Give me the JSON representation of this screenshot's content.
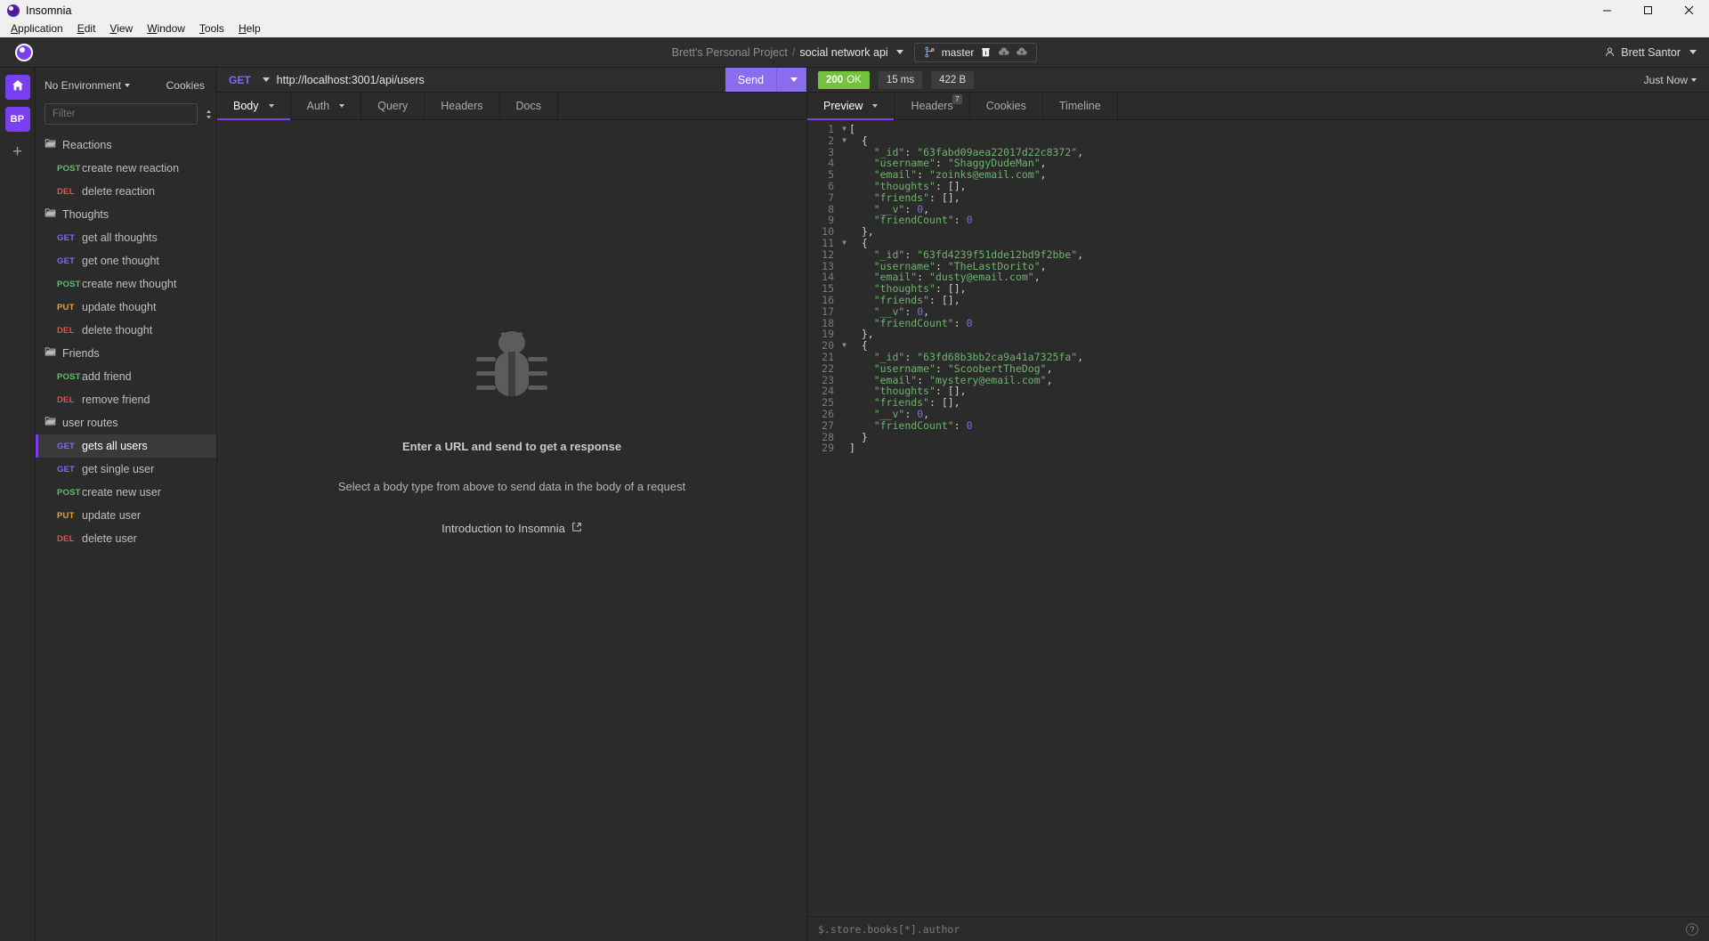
{
  "titlebar": {
    "app_name": "Insomnia",
    "minimize": "minimize-icon",
    "maximize": "maximize-icon",
    "close": "close-icon"
  },
  "menubar": {
    "items": [
      {
        "label": "Application",
        "accel": "A"
      },
      {
        "label": "Edit",
        "accel": "E"
      },
      {
        "label": "View",
        "accel": "V"
      },
      {
        "label": "Window",
        "accel": "W"
      },
      {
        "label": "Tools",
        "accel": "T"
      },
      {
        "label": "Help",
        "accel": "H"
      }
    ]
  },
  "header": {
    "project_name": "Brett's Personal Project",
    "separator": "/",
    "workspace_name": "social network api",
    "git": {
      "branch": "master",
      "icons": [
        "git-branch-icon",
        "trash-icon",
        "cloud-download-icon",
        "cloud-upload-icon"
      ]
    },
    "user": {
      "name": "Brett Santor",
      "icon": "user-icon"
    }
  },
  "rail": {
    "home_label": "home-icon",
    "project_initials": "BP",
    "add_label": "+"
  },
  "sidebar": {
    "environment": "No Environment",
    "cookies_label": "Cookies",
    "filter_placeholder": "Filter",
    "filter_value": "",
    "sort_icon": "sort-icon",
    "add_icon": "plus-circle-icon",
    "tree": [
      {
        "type": "folder",
        "name": "Reactions"
      },
      {
        "type": "request",
        "method": "POST",
        "name": "create new reaction",
        "active": false
      },
      {
        "type": "request",
        "method": "DEL",
        "name": "delete reaction",
        "active": false
      },
      {
        "type": "folder",
        "name": "Thoughts"
      },
      {
        "type": "request",
        "method": "GET",
        "name": "get all thoughts",
        "active": false
      },
      {
        "type": "request",
        "method": "GET",
        "name": "get one thought",
        "active": false
      },
      {
        "type": "request",
        "method": "POST",
        "name": "create new thought",
        "active": false
      },
      {
        "type": "request",
        "method": "PUT",
        "name": "update thought",
        "active": false
      },
      {
        "type": "request",
        "method": "DEL",
        "name": "delete thought",
        "active": false
      },
      {
        "type": "folder",
        "name": "Friends"
      },
      {
        "type": "request",
        "method": "POST",
        "name": "add friend",
        "active": false
      },
      {
        "type": "request",
        "method": "DEL",
        "name": "remove friend",
        "active": false
      },
      {
        "type": "folder",
        "name": "user routes"
      },
      {
        "type": "request",
        "method": "GET",
        "name": "gets all users",
        "active": true
      },
      {
        "type": "request",
        "method": "GET",
        "name": "get single user",
        "active": false
      },
      {
        "type": "request",
        "method": "POST",
        "name": "create new user",
        "active": false
      },
      {
        "type": "request",
        "method": "PUT",
        "name": "update user",
        "active": false
      },
      {
        "type": "request",
        "method": "DEL",
        "name": "delete user",
        "active": false
      }
    ]
  },
  "request": {
    "method": "GET",
    "url": "http://localhost:3001/api/users",
    "send_label": "Send",
    "tabs": [
      {
        "label": "Body",
        "active": true,
        "caret": true
      },
      {
        "label": "Auth",
        "active": false,
        "caret": true
      },
      {
        "label": "Query",
        "active": false,
        "caret": false
      },
      {
        "label": "Headers",
        "active": false,
        "caret": false
      },
      {
        "label": "Docs",
        "active": false,
        "caret": false
      }
    ],
    "empty": {
      "illustration": "bug-icon",
      "title": "Enter a URL and send to get a response",
      "subtitle": "Select a body type from above to send data in the body of a request",
      "link": "Introduction to Insomnia",
      "link_icon": "external-link-icon"
    }
  },
  "response": {
    "status_code": "200",
    "status_text": "OK",
    "time": "15 ms",
    "size": "422 B",
    "timestamp": "Just Now",
    "tabs": [
      {
        "label": "Preview",
        "active": true,
        "caret": true,
        "badge": ""
      },
      {
        "label": "Headers",
        "active": false,
        "caret": false,
        "badge": "7"
      },
      {
        "label": "Cookies",
        "active": false,
        "caret": false,
        "badge": ""
      },
      {
        "label": "Timeline",
        "active": false,
        "caret": false,
        "badge": ""
      }
    ],
    "filter_placeholder": "$.store.books[*].author",
    "filter_value": "",
    "help_icon": "question-mark-icon",
    "lines": [
      {
        "n": 1,
        "fold": true,
        "tokens": [
          {
            "t": "[",
            "c": "p"
          }
        ],
        "indent": 0
      },
      {
        "n": 2,
        "fold": true,
        "tokens": [
          {
            "t": "{",
            "c": "p"
          }
        ],
        "indent": 1
      },
      {
        "n": 3,
        "fold": false,
        "tokens": [
          {
            "t": "\"_id\"",
            "c": "k"
          },
          {
            "t": ": ",
            "c": "p"
          },
          {
            "t": "\"63fabd09aea22017d22c8372\"",
            "c": "s"
          },
          {
            "t": ",",
            "c": "p"
          }
        ],
        "indent": 2
      },
      {
        "n": 4,
        "fold": false,
        "tokens": [
          {
            "t": "\"username\"",
            "c": "k"
          },
          {
            "t": ": ",
            "c": "p"
          },
          {
            "t": "\"ShaggyDudeMan\"",
            "c": "s"
          },
          {
            "t": ",",
            "c": "p"
          }
        ],
        "indent": 2
      },
      {
        "n": 5,
        "fold": false,
        "tokens": [
          {
            "t": "\"email\"",
            "c": "k"
          },
          {
            "t": ": ",
            "c": "p"
          },
          {
            "t": "\"zoinks@email.com\"",
            "c": "s"
          },
          {
            "t": ",",
            "c": "p"
          }
        ],
        "indent": 2
      },
      {
        "n": 6,
        "fold": false,
        "tokens": [
          {
            "t": "\"thoughts\"",
            "c": "k"
          },
          {
            "t": ": [],",
            "c": "p"
          }
        ],
        "indent": 2
      },
      {
        "n": 7,
        "fold": false,
        "tokens": [
          {
            "t": "\"friends\"",
            "c": "k"
          },
          {
            "t": ": [],",
            "c": "p"
          }
        ],
        "indent": 2
      },
      {
        "n": 8,
        "fold": false,
        "tokens": [
          {
            "t": "\"__v\"",
            "c": "k"
          },
          {
            "t": ": ",
            "c": "p"
          },
          {
            "t": "0",
            "c": "n"
          },
          {
            "t": ",",
            "c": "p"
          }
        ],
        "indent": 2
      },
      {
        "n": 9,
        "fold": false,
        "tokens": [
          {
            "t": "\"friendCount\"",
            "c": "k"
          },
          {
            "t": ": ",
            "c": "p"
          },
          {
            "t": "0",
            "c": "n"
          }
        ],
        "indent": 2
      },
      {
        "n": 10,
        "fold": false,
        "tokens": [
          {
            "t": "},",
            "c": "p"
          }
        ],
        "indent": 1
      },
      {
        "n": 11,
        "fold": true,
        "tokens": [
          {
            "t": "{",
            "c": "p"
          }
        ],
        "indent": 1
      },
      {
        "n": 12,
        "fold": false,
        "tokens": [
          {
            "t": "\"_id\"",
            "c": "k"
          },
          {
            "t": ": ",
            "c": "p"
          },
          {
            "t": "\"63fd4239f51dde12bd9f2bbe\"",
            "c": "s"
          },
          {
            "t": ",",
            "c": "p"
          }
        ],
        "indent": 2
      },
      {
        "n": 13,
        "fold": false,
        "tokens": [
          {
            "t": "\"username\"",
            "c": "k"
          },
          {
            "t": ": ",
            "c": "p"
          },
          {
            "t": "\"TheLastDorito\"",
            "c": "s"
          },
          {
            "t": ",",
            "c": "p"
          }
        ],
        "indent": 2
      },
      {
        "n": 14,
        "fold": false,
        "tokens": [
          {
            "t": "\"email\"",
            "c": "k"
          },
          {
            "t": ": ",
            "c": "p"
          },
          {
            "t": "\"dusty@email.com\"",
            "c": "s"
          },
          {
            "t": ",",
            "c": "p"
          }
        ],
        "indent": 2
      },
      {
        "n": 15,
        "fold": false,
        "tokens": [
          {
            "t": "\"thoughts\"",
            "c": "k"
          },
          {
            "t": ": [],",
            "c": "p"
          }
        ],
        "indent": 2
      },
      {
        "n": 16,
        "fold": false,
        "tokens": [
          {
            "t": "\"friends\"",
            "c": "k"
          },
          {
            "t": ": [],",
            "c": "p"
          }
        ],
        "indent": 2
      },
      {
        "n": 17,
        "fold": false,
        "tokens": [
          {
            "t": "\"__v\"",
            "c": "k"
          },
          {
            "t": ": ",
            "c": "p"
          },
          {
            "t": "0",
            "c": "n"
          },
          {
            "t": ",",
            "c": "p"
          }
        ],
        "indent": 2
      },
      {
        "n": 18,
        "fold": false,
        "tokens": [
          {
            "t": "\"friendCount\"",
            "c": "k"
          },
          {
            "t": ": ",
            "c": "p"
          },
          {
            "t": "0",
            "c": "n"
          }
        ],
        "indent": 2
      },
      {
        "n": 19,
        "fold": false,
        "tokens": [
          {
            "t": "},",
            "c": "p"
          }
        ],
        "indent": 1
      },
      {
        "n": 20,
        "fold": true,
        "tokens": [
          {
            "t": "{",
            "c": "p"
          }
        ],
        "indent": 1
      },
      {
        "n": 21,
        "fold": false,
        "tokens": [
          {
            "t": "\"_id\"",
            "c": "k"
          },
          {
            "t": ": ",
            "c": "p"
          },
          {
            "t": "\"63fd68b3bb2ca9a41a7325fa\"",
            "c": "s"
          },
          {
            "t": ",",
            "c": "p"
          }
        ],
        "indent": 2
      },
      {
        "n": 22,
        "fold": false,
        "tokens": [
          {
            "t": "\"username\"",
            "c": "k"
          },
          {
            "t": ": ",
            "c": "p"
          },
          {
            "t": "\"ScoobertTheDog\"",
            "c": "s"
          },
          {
            "t": ",",
            "c": "p"
          }
        ],
        "indent": 2
      },
      {
        "n": 23,
        "fold": false,
        "tokens": [
          {
            "t": "\"email\"",
            "c": "k"
          },
          {
            "t": ": ",
            "c": "p"
          },
          {
            "t": "\"mystery@email.com\"",
            "c": "s"
          },
          {
            "t": ",",
            "c": "p"
          }
        ],
        "indent": 2
      },
      {
        "n": 24,
        "fold": false,
        "tokens": [
          {
            "t": "\"thoughts\"",
            "c": "k"
          },
          {
            "t": ": [],",
            "c": "p"
          }
        ],
        "indent": 2
      },
      {
        "n": 25,
        "fold": false,
        "tokens": [
          {
            "t": "\"friends\"",
            "c": "k"
          },
          {
            "t": ": [],",
            "c": "p"
          }
        ],
        "indent": 2
      },
      {
        "n": 26,
        "fold": false,
        "tokens": [
          {
            "t": "\"__v\"",
            "c": "k"
          },
          {
            "t": ": ",
            "c": "p"
          },
          {
            "t": "0",
            "c": "n"
          },
          {
            "t": ",",
            "c": "p"
          }
        ],
        "indent": 2
      },
      {
        "n": 27,
        "fold": false,
        "tokens": [
          {
            "t": "\"friendCount\"",
            "c": "k"
          },
          {
            "t": ": ",
            "c": "p"
          },
          {
            "t": "0",
            "c": "n"
          }
        ],
        "indent": 2
      },
      {
        "n": 28,
        "fold": false,
        "tokens": [
          {
            "t": "}",
            "c": "p"
          }
        ],
        "indent": 1
      },
      {
        "n": 29,
        "fold": false,
        "tokens": [
          {
            "t": "]",
            "c": "p"
          }
        ],
        "indent": 0
      }
    ]
  },
  "colors": {
    "accent": "#7b3ff2",
    "send": "#8b6ef0",
    "status_ok": "#74c13d",
    "get": "#7b6cf6",
    "post": "#5ec269",
    "put": "#e5a03a",
    "del": "#e05252"
  }
}
